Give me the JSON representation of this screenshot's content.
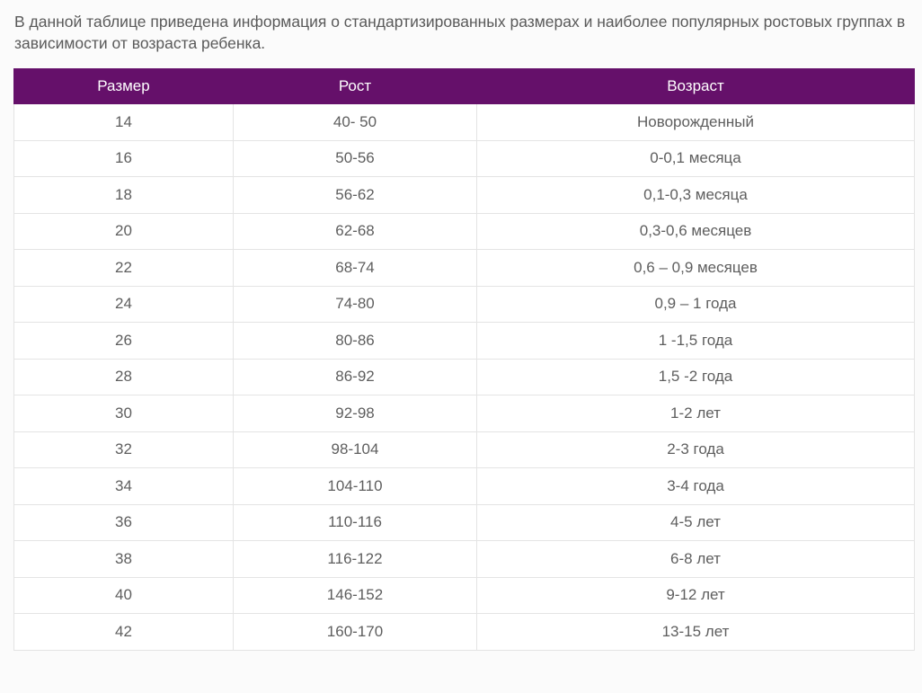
{
  "intro_text": "В данной таблице приведена информация о стандартизированных размерах и наиболее популярных ростовых группах в зависимости от возраста ребенка.",
  "table": {
    "columns": [
      "Размер",
      "Рост",
      "Возраст"
    ],
    "rows": [
      [
        "14",
        "40- 50",
        "Новорожденный"
      ],
      [
        "16",
        "50-56",
        "0-0,1 месяца"
      ],
      [
        "18",
        "56-62",
        "0,1-0,3 месяца"
      ],
      [
        "20",
        "62-68",
        "0,3-0,6 месяцев"
      ],
      [
        "22",
        "68-74",
        "0,6 – 0,9 месяцев"
      ],
      [
        "24",
        "74-80",
        "0,9 – 1 года"
      ],
      [
        "26",
        "80-86",
        "1 -1,5 года"
      ],
      [
        "28",
        "86-92",
        "1,5 -2 года"
      ],
      [
        "30",
        "92-98",
        "1-2 лет"
      ],
      [
        "32",
        "98-104",
        "2-3 года"
      ],
      [
        "34",
        "104-110",
        "3-4 года"
      ],
      [
        "36",
        "110-116",
        "4-5 лет"
      ],
      [
        "38",
        "116-122",
        "6-8 лет"
      ],
      [
        "40",
        "146-152",
        "9-12 лет"
      ],
      [
        "42",
        "160-170",
        "13-15 лет"
      ]
    ]
  },
  "colors": {
    "header_bg": "#65106a",
    "header_text": "#ffffff",
    "border": "#e4e4e4",
    "text": "#5e5e5e"
  }
}
